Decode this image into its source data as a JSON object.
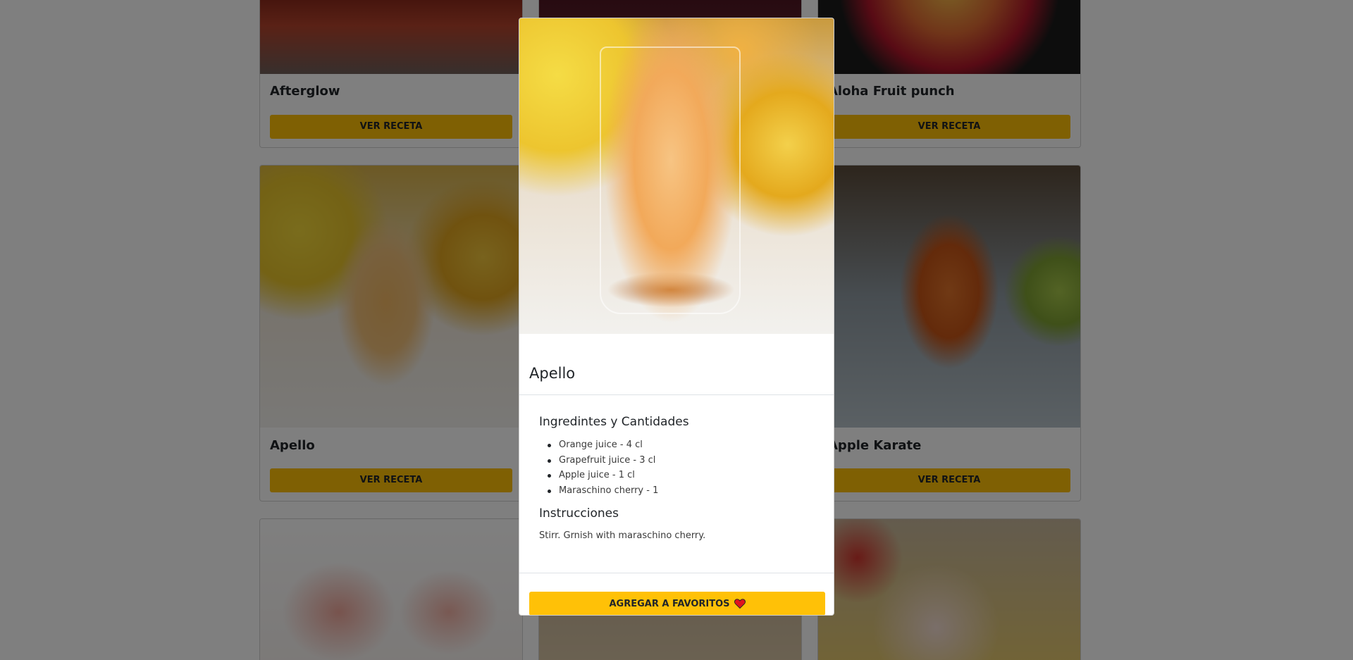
{
  "cards": [
    {
      "title": "Afterglow",
      "button": "VER RECETA"
    },
    {
      "title": "Aloha Fruit punch",
      "button": "VER RECETA"
    },
    {
      "title": "Apello",
      "button": "VER RECETA"
    },
    {
      "title": "Apple Karate",
      "button": "VER RECETA"
    }
  ],
  "modal": {
    "title": "Apello",
    "ingredients_heading": "Ingredintes y Cantidades",
    "ingredients": [
      "Orange juice - 4 cl",
      "Grapefruit juice - 3 cl",
      "Apple juice - 1 cl",
      "Maraschino cherry - 1"
    ],
    "instructions_heading": "Instrucciones",
    "instructions": "Stirr. Grnish with maraschino cherry.",
    "favorite_button": "AGREGAR A FAVORITOS",
    "favorite_icon": "heart-icon"
  },
  "colors": {
    "accent": "#ffc107",
    "heart": "#e0141e",
    "backdrop": "rgba(0,0,0,0.5)"
  }
}
